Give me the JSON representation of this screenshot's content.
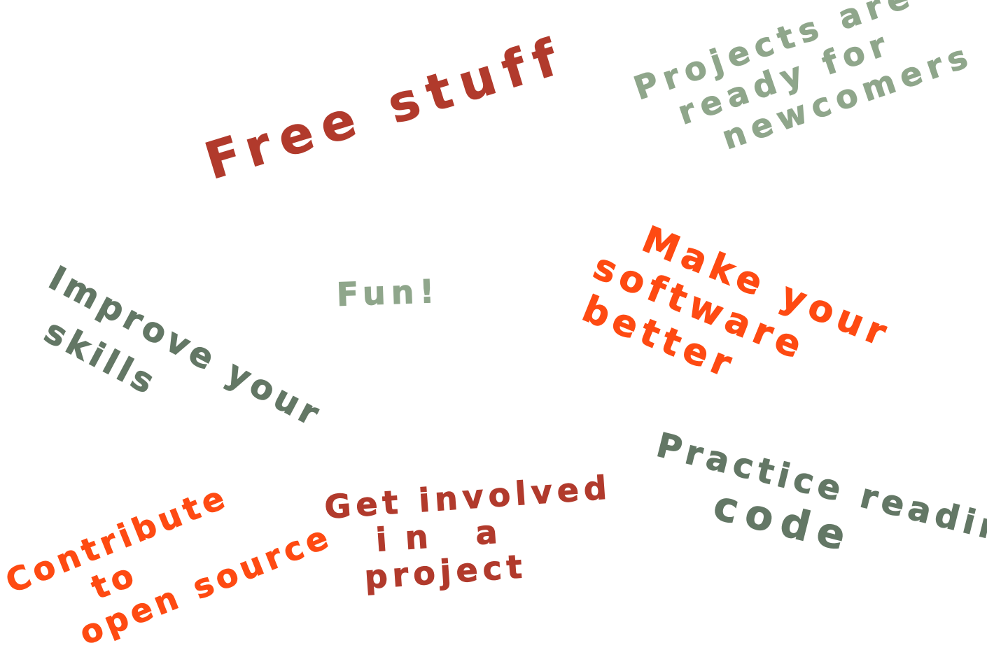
{
  "colors": {
    "brick": "#b13a2c",
    "sage": "#8fa68b",
    "slate": "#637765",
    "orange": "#fe4a12"
  },
  "phrases": {
    "free_stuff": {
      "lines": [
        "Free stuff"
      ],
      "color": "brick"
    },
    "projects_ready": {
      "lines": [
        "Projects are",
        "ready for",
        "newcomers"
      ],
      "color": "sage"
    },
    "fun": {
      "lines": [
        "Fun!"
      ],
      "color": "sage"
    },
    "improve_skills": {
      "lines": [
        "Improve your",
        "skills"
      ],
      "color": "slate"
    },
    "make_software_better": {
      "lines": [
        "Make your",
        "software",
        "better"
      ],
      "color": "orange"
    },
    "practice_reading_code": {
      "lines": [
        "Practice reading",
        "code"
      ],
      "color": "slate"
    },
    "get_involved": {
      "lines": [
        "Get involved",
        "in a",
        "project"
      ],
      "color": "brick"
    },
    "contribute_open_source": {
      "lines": [
        "Contribute",
        "to",
        "open source"
      ],
      "color": "orange"
    }
  }
}
